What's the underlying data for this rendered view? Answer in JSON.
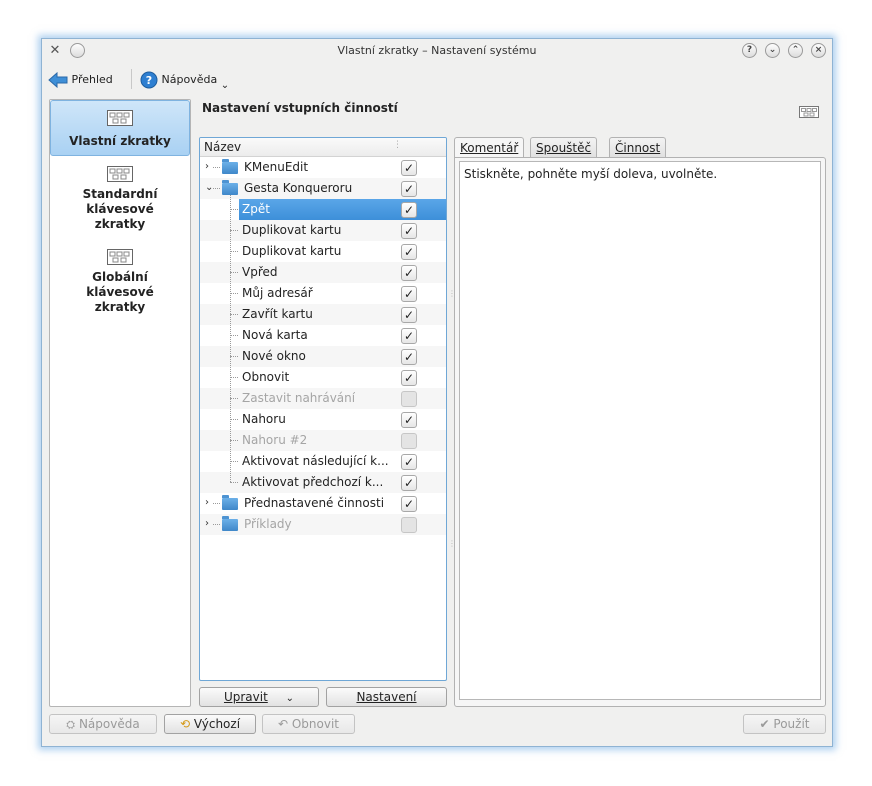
{
  "window": {
    "title": "Vlastní zkratky – Nastavení systému"
  },
  "toolbar": {
    "overview_label": "Přehled",
    "help_label": "Nápověda"
  },
  "sidebar": {
    "items": [
      {
        "label": "Vlastní zkratky",
        "active": true
      },
      {
        "label": "Standardní klávesové zkratky",
        "active": false
      },
      {
        "label": "Globální klávesové zkratky",
        "active": false
      }
    ]
  },
  "main": {
    "section_title": "Nastavení vstupních činností",
    "tree_header": "Název",
    "tree": [
      {
        "label": "KMenuEdit",
        "level": 0,
        "type": "folder",
        "expanded": false,
        "checked": true,
        "enabled": true
      },
      {
        "label": "Gesta Konqueroru",
        "level": 0,
        "type": "folder",
        "expanded": true,
        "checked": true,
        "enabled": true
      },
      {
        "label": "Zpět",
        "level": 1,
        "type": "item",
        "checked": true,
        "enabled": true,
        "selected": true
      },
      {
        "label": "Duplikovat kartu",
        "level": 1,
        "type": "item",
        "checked": true,
        "enabled": true
      },
      {
        "label": "Duplikovat kartu",
        "level": 1,
        "type": "item",
        "checked": true,
        "enabled": true
      },
      {
        "label": "Vpřed",
        "level": 1,
        "type": "item",
        "checked": true,
        "enabled": true
      },
      {
        "label": "Můj adresář",
        "level": 1,
        "type": "item",
        "checked": true,
        "enabled": true
      },
      {
        "label": "Zavřít kartu",
        "level": 1,
        "type": "item",
        "checked": true,
        "enabled": true
      },
      {
        "label": "Nová karta",
        "level": 1,
        "type": "item",
        "checked": true,
        "enabled": true
      },
      {
        "label": "Nové okno",
        "level": 1,
        "type": "item",
        "checked": true,
        "enabled": true
      },
      {
        "label": "Obnovit",
        "level": 1,
        "type": "item",
        "checked": true,
        "enabled": true
      },
      {
        "label": "Zastavit nahrávání",
        "level": 1,
        "type": "item",
        "checked": false,
        "enabled": false
      },
      {
        "label": "Nahoru",
        "level": 1,
        "type": "item",
        "checked": true,
        "enabled": true
      },
      {
        "label": "Nahoru #2",
        "level": 1,
        "type": "item",
        "checked": false,
        "enabled": false
      },
      {
        "label": "Aktivovat následující k...",
        "level": 1,
        "type": "item",
        "checked": true,
        "enabled": true
      },
      {
        "label": "Aktivovat předchozí k...",
        "level": 1,
        "type": "item",
        "checked": true,
        "enabled": true
      },
      {
        "label": "Přednastavené činnosti",
        "level": 0,
        "type": "folder",
        "expanded": false,
        "checked": true,
        "enabled": true
      },
      {
        "label": "Příklady",
        "level": 0,
        "type": "folder",
        "expanded": false,
        "checked": false,
        "enabled": false
      }
    ],
    "edit_button": "Upravit",
    "settings_button": "Nastavení",
    "tabs": [
      {
        "label": "Komentář",
        "active": true
      },
      {
        "label": "Spouštěč",
        "active": false
      },
      {
        "label": "Činnost",
        "active": false
      }
    ],
    "comment": "Stiskněte, pohněte myší doleva, uvolněte."
  },
  "footer": {
    "help_button": "Nápověda",
    "defaults_button": "Výchozí",
    "reset_button": "Obnovit",
    "apply_button": "Použít"
  },
  "colors": {
    "selection": "#3d8fd9",
    "window_glow": "#6eaae1",
    "folder": "#3f87c9"
  }
}
